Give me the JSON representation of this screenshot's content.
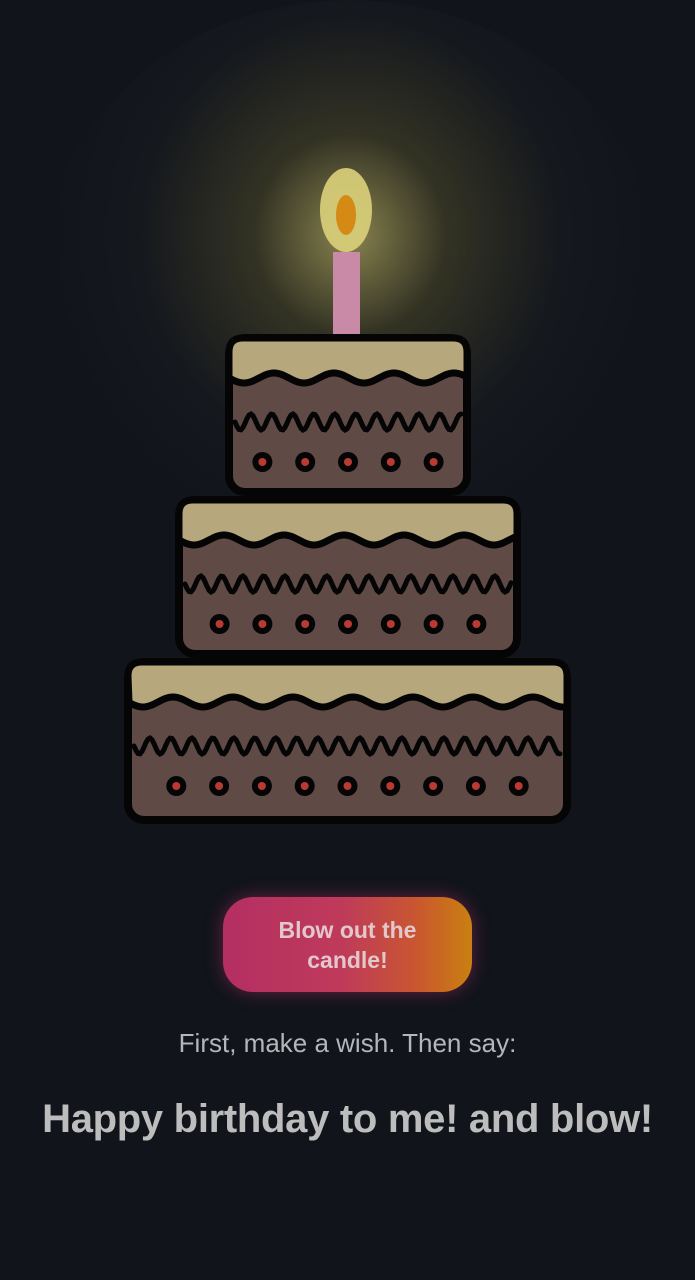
{
  "colors": {
    "background": "#11141b",
    "icing": "#b7a77c",
    "cake_body": "#5f4a46",
    "outline": "#050505",
    "dot_center": "#b83a32",
    "candle": "#c98aa8",
    "flame_outer": "#d9cf7a",
    "flame_inner": "#d48a15",
    "button_start": "#b42f62",
    "button_end": "#c98010",
    "text": "#bdbdbe"
  },
  "cake": {
    "tiers": [
      {
        "name": "top",
        "dots": 5
      },
      {
        "name": "middle",
        "dots": 7
      },
      {
        "name": "bottom",
        "dots": 9
      }
    ],
    "candle_lit": true
  },
  "action": {
    "button_label": "Blow out the candle!",
    "button_icon": "none"
  },
  "instructions": {
    "hint": "First, make a wish. Then say:",
    "phrase": "Happy birthday to me! and blow!"
  }
}
